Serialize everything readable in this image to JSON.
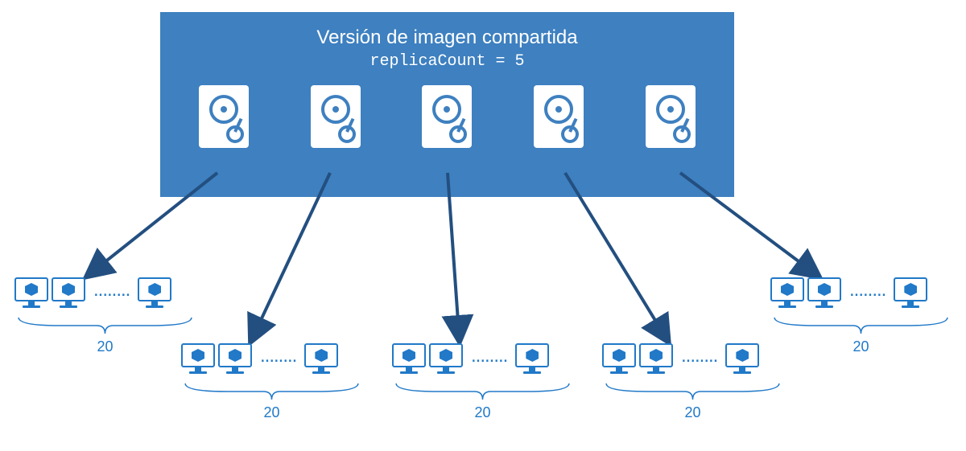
{
  "title": "Versión de imagen compartida",
  "subtitle": "replicaCount = 5",
  "replica_count": 5,
  "groups": [
    {
      "count_label": "20"
    },
    {
      "count_label": "20"
    },
    {
      "count_label": "20"
    },
    {
      "count_label": "20"
    },
    {
      "count_label": "20"
    }
  ],
  "colors": {
    "box": "#3e80c0",
    "accent": "#2179c8",
    "arrow": "#234f80"
  }
}
